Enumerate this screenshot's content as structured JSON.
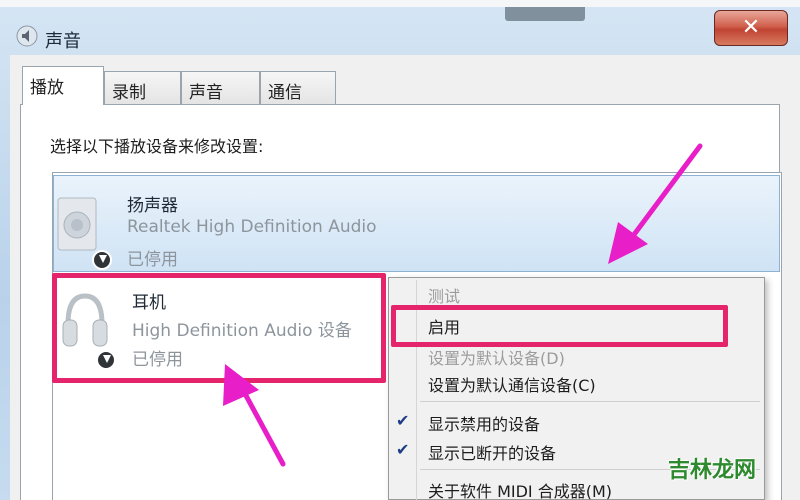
{
  "window": {
    "title": "声音",
    "close_glyph": "✕"
  },
  "tabs": [
    {
      "label": "播放",
      "active": true
    },
    {
      "label": "录制",
      "active": false
    },
    {
      "label": "声音",
      "active": false
    },
    {
      "label": "通信",
      "active": false
    }
  ],
  "instruction": "选择以下播放设备来修改设置:",
  "devices": [
    {
      "name": "扬声器",
      "driver": "Realtek High Definition Audio",
      "status": "已停用",
      "icon": "speaker-icon",
      "selected": true
    },
    {
      "name": "耳机",
      "driver": "High Definition Audio 设备",
      "status": "已停用",
      "icon": "headphones-icon",
      "selected": false
    }
  ],
  "context_menu": {
    "items": [
      {
        "label": "测试",
        "disabled": true,
        "checked": false
      },
      {
        "label": "启用",
        "disabled": false,
        "checked": false
      },
      {
        "label": "设置为默认设备(D)",
        "disabled": true,
        "checked": false
      },
      {
        "label": "设置为默认通信设备(C)",
        "disabled": false,
        "checked": false
      },
      {
        "label": "显示禁用的设备",
        "disabled": false,
        "checked": true
      },
      {
        "label": "显示已断开的设备",
        "disabled": false,
        "checked": true
      },
      {
        "label": "关于软件 MIDI 合成器(M)",
        "disabled": false,
        "checked": false
      }
    ]
  },
  "annotations": {
    "highlight_color": "#e5256b",
    "arrow_color": "#e81ec8"
  },
  "watermark": "吉林龙网"
}
